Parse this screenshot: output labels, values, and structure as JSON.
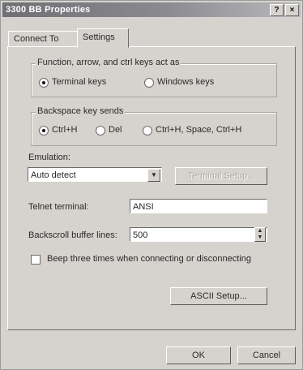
{
  "window": {
    "title": "3300 BB Properties",
    "help_button": "?",
    "close_button": "×"
  },
  "tabs": [
    {
      "label": "Connect To"
    },
    {
      "label": "Settings"
    }
  ],
  "function_keys": {
    "label": "Function, arrow, and ctrl keys act as",
    "options": [
      {
        "label": "Terminal keys",
        "selected": true
      },
      {
        "label": "Windows keys",
        "selected": false
      }
    ]
  },
  "backspace": {
    "label": "Backspace key sends",
    "options": [
      {
        "label": "Ctrl+H",
        "selected": true
      },
      {
        "label": "Del",
        "selected": false
      },
      {
        "label": "Ctrl+H, Space, Ctrl+H",
        "selected": false
      }
    ]
  },
  "emulation": {
    "label": "Emulation:",
    "value": "Auto detect",
    "setup_button": "Terminal Setup..."
  },
  "telnet": {
    "label": "Telnet terminal:",
    "value": "ANSI"
  },
  "backscroll": {
    "label": "Backscroll buffer lines:",
    "value": "500"
  },
  "beep": {
    "label": "Beep three times when connecting or disconnecting",
    "checked": false
  },
  "ascii_button": "ASCII Setup...",
  "ok_button": "OK",
  "cancel_button": "Cancel"
}
